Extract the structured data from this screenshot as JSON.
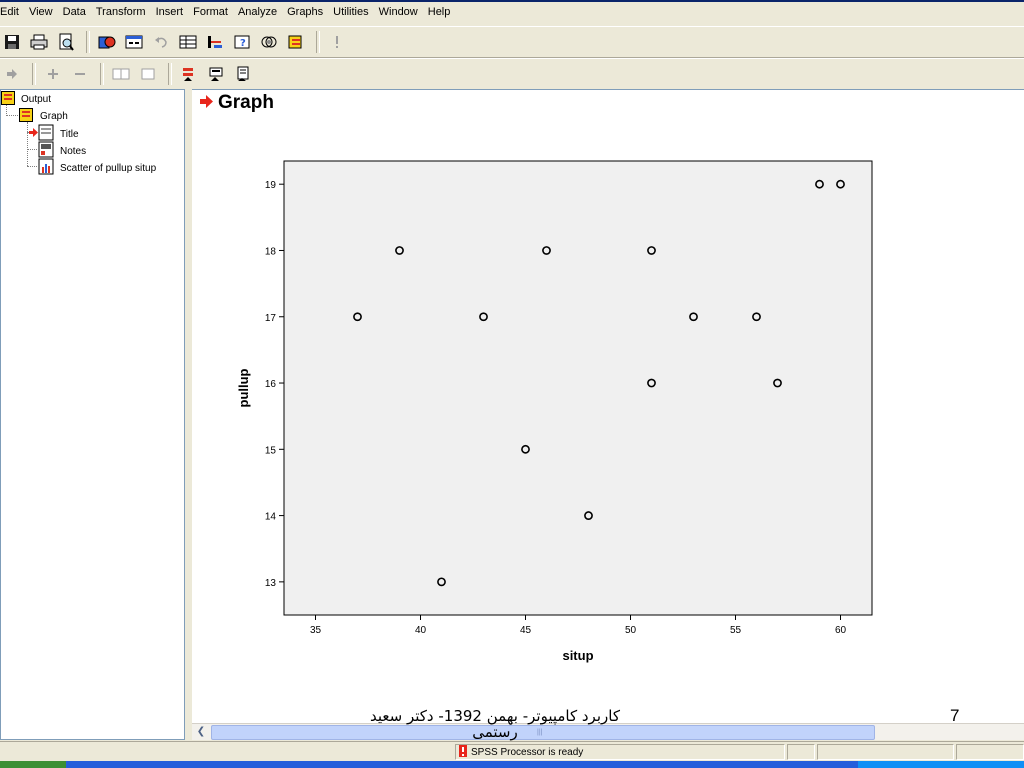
{
  "menu": {
    "items": [
      "Edit",
      "View",
      "Data",
      "Transform",
      "Insert",
      "Format",
      "Analyze",
      "Graphs",
      "Utilities",
      "Window",
      "Help"
    ]
  },
  "toolbar1": {
    "icons": [
      "save-icon",
      "print-icon",
      "print-preview-icon",
      "export-icon",
      "dialog-recall-icon",
      "undo-icon",
      "goto-data-icon",
      "goto-case-icon",
      "variables-icon",
      "use-sets-icon",
      "designate-window-icon",
      "run-syntax-icon"
    ]
  },
  "toolbar2": {
    "icons": [
      "promote-icon",
      "expand-icon",
      "collapse-icon",
      "show-icon",
      "hide-icon",
      "insert-heading-icon",
      "insert-title-icon",
      "insert-text-icon"
    ]
  },
  "outline": {
    "root": "Output",
    "graph": "Graph",
    "children": [
      "Title",
      "Notes",
      "Scatter of pullup situp"
    ]
  },
  "content": {
    "heading": "Graph"
  },
  "chart_data": {
    "type": "scatter",
    "title": "",
    "xlabel": "situp",
    "ylabel": "pullup",
    "xlim": [
      33.5,
      61.5
    ],
    "ylim": [
      12.5,
      19.35
    ],
    "xticks": [
      35,
      40,
      45,
      50,
      55,
      60
    ],
    "yticks": [
      13,
      14,
      15,
      16,
      17,
      18,
      19
    ],
    "grid": false,
    "background": "#f0f0f0",
    "points": [
      {
        "x": 37,
        "y": 17
      },
      {
        "x": 39,
        "y": 18
      },
      {
        "x": 41,
        "y": 13
      },
      {
        "x": 43,
        "y": 17
      },
      {
        "x": 45,
        "y": 15
      },
      {
        "x": 46,
        "y": 18
      },
      {
        "x": 48,
        "y": 14
      },
      {
        "x": 51,
        "y": 18
      },
      {
        "x": 51,
        "y": 16
      },
      {
        "x": 53,
        "y": 17
      },
      {
        "x": 56,
        "y": 17
      },
      {
        "x": 57,
        "y": 16
      },
      {
        "x": 59,
        "y": 19
      },
      {
        "x": 60,
        "y": 19
      }
    ]
  },
  "status": {
    "processor": "SPSS Processor  is ready"
  },
  "slide": {
    "footer_line1": "کاربرد کامپیوتر- بهمن 1392- دکتر سعید",
    "footer_line2": "رستمی",
    "number": "7"
  },
  "colors": {
    "accent_red": "#e8261c",
    "chart_bg": "#f0f0f0",
    "tree_icon_yellow": "#f7d117"
  }
}
